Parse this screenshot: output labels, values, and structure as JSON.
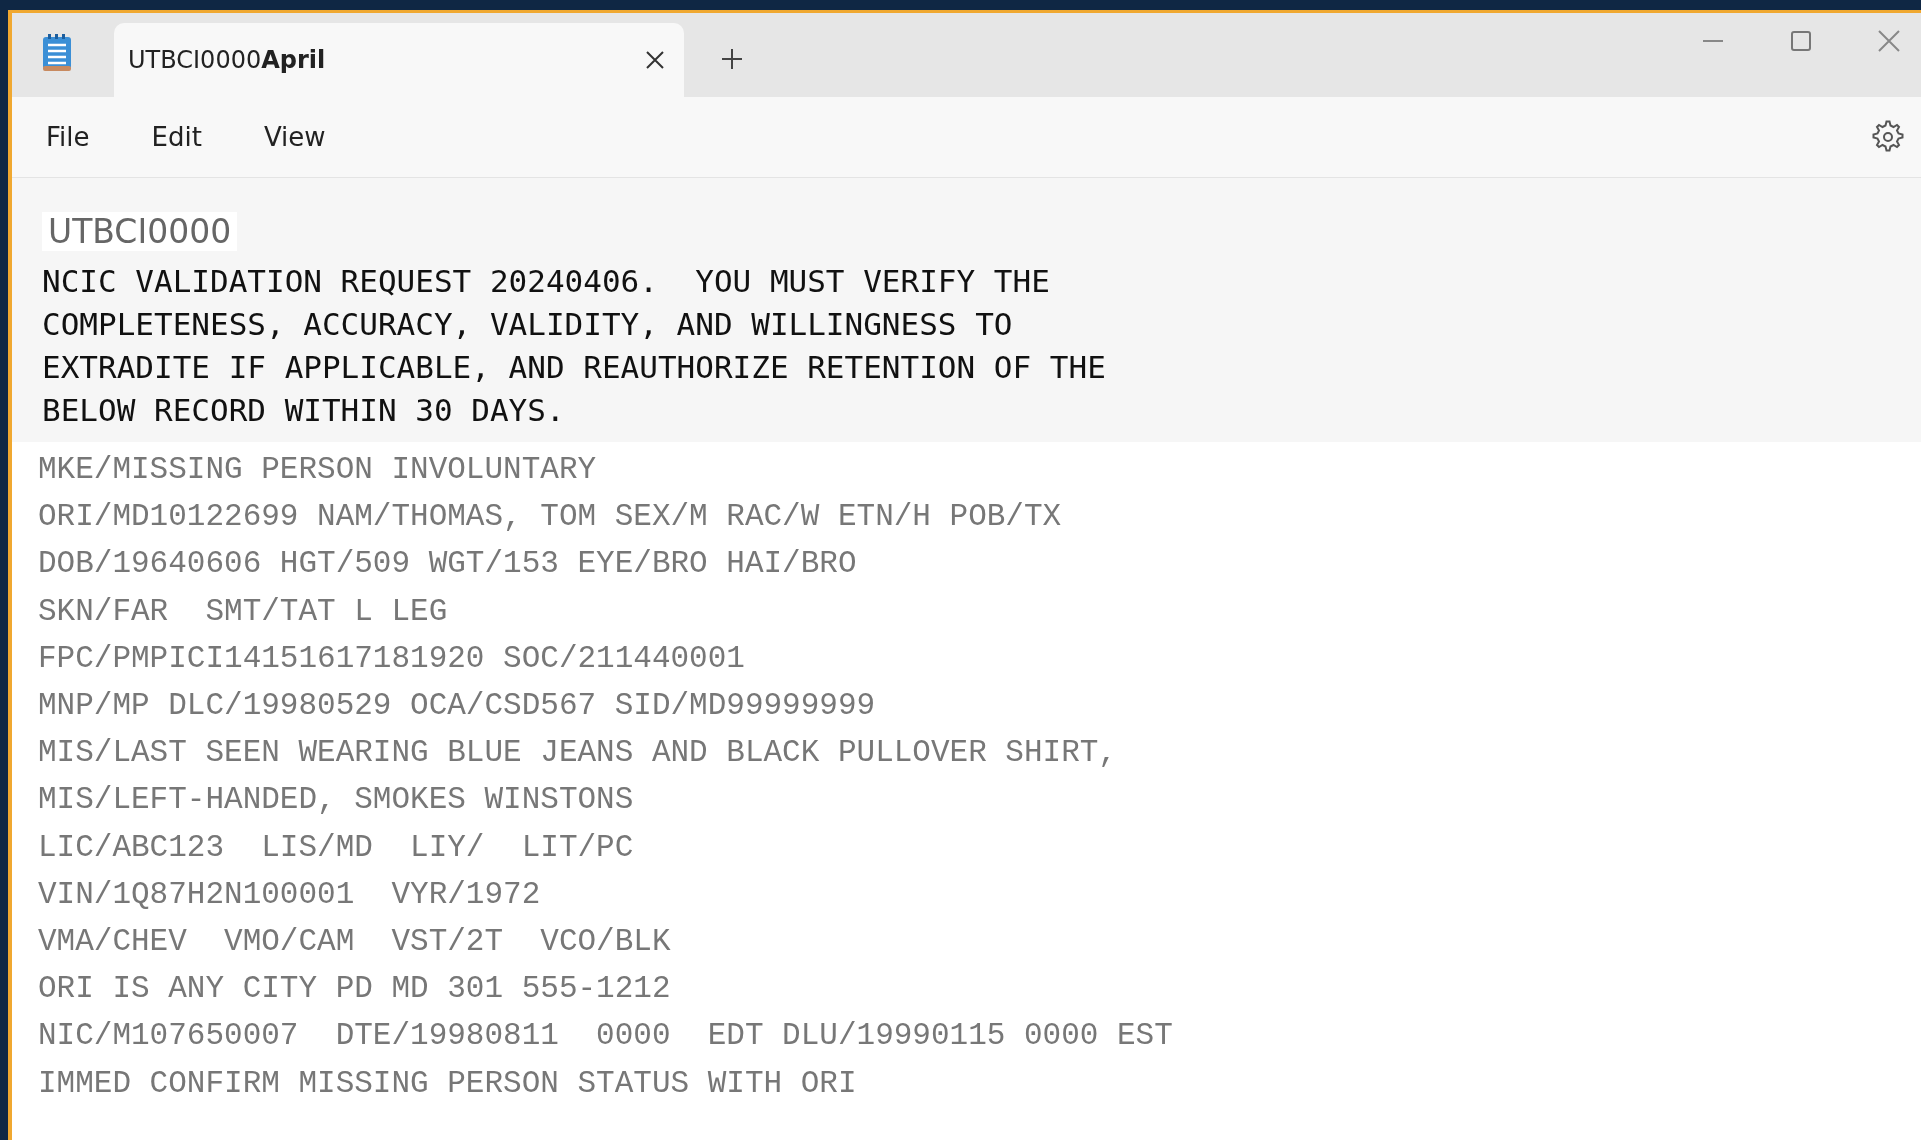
{
  "tabs": [
    {
      "label": "UTBCI0000**April**",
      "selected": true
    }
  ],
  "menu": [
    "File",
    "Edit",
    "View"
  ],
  "document": {
    "heading": "UTBCI0000",
    "notice": [
      "NCIC VALIDATION REQUEST 20240406.  YOU MUST VERIFY THE",
      "COMPLETENESS, ACCURACY, VALIDITY, AND WILLINGNESS TO",
      "EXTRADITE IF APPLICABLE, AND REAUTHORIZE RETENTION OF THE",
      "BELOW RECORD WITHIN 30 DAYS."
    ],
    "record": [
      "MKE/MISSING PERSON INVOLUNTARY",
      "ORI/MD10122699 NAM/THOMAS, TOM SEX/M RAC/W ETN/H POB/TX",
      "DOB/19640606 HGT/509 WGT/153 EYE/BRO HAI/BRO",
      "SKN/FAR  SMT/TAT L LEG",
      "FPC/PMPICI14151617181920 SOC/211440001",
      "MNP/MP DLC/19980529 OCA/CSD567 SID/MD99999999",
      "MIS/LAST SEEN WEARING BLUE JEANS AND BLACK PULLOVER SHIRT,",
      "MIS/LEFT-HANDED, SMOKES WINSTONS",
      "LIC/ABC123  LIS/MD  LIY/  LIT/PC",
      "VIN/1Q87H2N100001  VYR/1972",
      "VMA/CHEV  VMO/CAM  VST/2T  VCO/BLK",
      "ORI IS ANY CITY PD MD 301 555-1212",
      "NIC/M107650007  DTE/19980811  0000  EDT DLU/19990115 0000 EST",
      "IMMED CONFIRM MISSING PERSON STATUS WITH ORI"
    ]
  }
}
